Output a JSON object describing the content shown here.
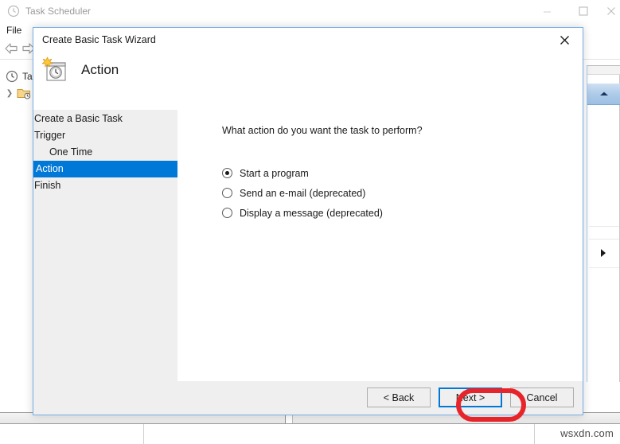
{
  "background_window": {
    "title": "Task Scheduler",
    "title_icon": "clock-icon",
    "menu": {
      "file": "File"
    },
    "toolbar": {
      "back_icon": "back-arrow-icon",
      "forward_icon": "forward-arrow-icon"
    },
    "tree": {
      "root_label": "Tas",
      "root_icon": "clock-icon",
      "child_icon": "task-folder-icon",
      "child_chevron": "chevron-right-icon"
    },
    "window_controls": {
      "minimize": "minimize-icon",
      "maximize": "maximize-icon",
      "close": "close-icon"
    },
    "right_pane": {
      "collapse_icon": "chevron-up-icon",
      "expand_icon": "triangle-right-icon"
    }
  },
  "dialog": {
    "title": "Create Basic Task Wizard",
    "close_icon": "close-icon",
    "header": {
      "icon": "task-wizard-icon",
      "heading": "Action"
    },
    "nav": {
      "items": [
        {
          "label": "Create a Basic Task",
          "indent": false,
          "selected": false
        },
        {
          "label": "Trigger",
          "indent": false,
          "selected": false
        },
        {
          "label": "One Time",
          "indent": true,
          "selected": false
        },
        {
          "label": "Action",
          "indent": false,
          "selected": true
        },
        {
          "label": "Finish",
          "indent": false,
          "selected": false
        }
      ]
    },
    "content": {
      "question": "What action do you want the task to perform?",
      "options": [
        {
          "label": "Start a program",
          "checked": true
        },
        {
          "label": "Send an e-mail (deprecated)",
          "checked": false
        },
        {
          "label": "Display a message (deprecated)",
          "checked": false
        }
      ]
    },
    "footer": {
      "back_label": "< Back",
      "next_label": "Next >",
      "cancel_label": "Cancel"
    }
  },
  "annotation": {
    "highlight_target": "next-button",
    "color": "#e8242b"
  },
  "watermark": {
    "text": "wsxdn.com"
  },
  "colors": {
    "accent_blue": "#0078d7",
    "dialog_border": "#76aee8",
    "annotation_red": "#e8242b",
    "panel_gray": "#efefef"
  }
}
